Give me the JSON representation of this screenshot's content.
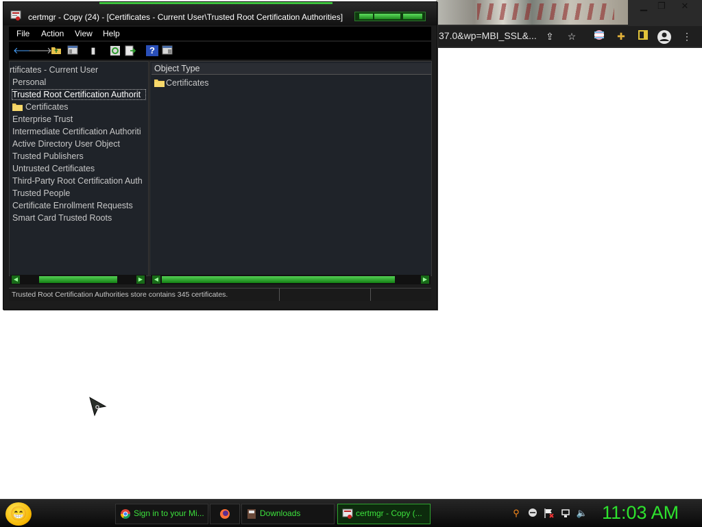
{
  "browser": {
    "url_fragment": "37.0&wp=MBI_SSL&...",
    "window_controls": [
      "minimize-icon",
      "restore-icon",
      "close-icon"
    ],
    "toolbar_icons": [
      "share-icon",
      "bookmark-star-icon",
      "profile-flag-icon",
      "extensions-puzzle-icon",
      "sidepanel-icon",
      "account-icon",
      "menu-kebab-icon"
    ]
  },
  "window": {
    "title": "certmgr - Copy (24) - [Certificates - Current User\\Trusted Root Certification Authorities]",
    "menu": [
      "File",
      "Action",
      "View",
      "Help"
    ],
    "toolbar_icons": [
      "back-icon",
      "forward-icon",
      "up-folder-icon",
      "show-tree-icon",
      "delete-icon",
      "refresh-icon",
      "export-icon",
      "help-icon",
      "properties-icon"
    ]
  },
  "tree": {
    "items": [
      {
        "label": "rtificates - Current User"
      },
      {
        "label": "Personal"
      },
      {
        "label": "Trusted Root Certification Authorit"
      },
      {
        "label": "Certificates"
      },
      {
        "label": "Enterprise Trust"
      },
      {
        "label": "Intermediate Certification Authoriti"
      },
      {
        "label": "Active Directory User Object"
      },
      {
        "label": "Trusted Publishers"
      },
      {
        "label": "Untrusted Certificates"
      },
      {
        "label": "Third-Party Root Certification Auth"
      },
      {
        "label": "Trusted People"
      },
      {
        "label": "Certificate Enrollment Requests"
      },
      {
        "label": "Smart Card Trusted Roots"
      }
    ]
  },
  "details": {
    "column_header": "Object Type",
    "rows": [
      {
        "label": "Certificates"
      }
    ]
  },
  "status": {
    "text": "Trusted Root Certification Authorities store contains 345 certificates."
  },
  "taskbar": {
    "tasks": [
      {
        "label": "Sign in to your Mi..."
      },
      {
        "label": ""
      },
      {
        "label": "Downloads"
      },
      {
        "label": "certmgr - Copy (..."
      }
    ],
    "clock": "11:03 AM"
  }
}
